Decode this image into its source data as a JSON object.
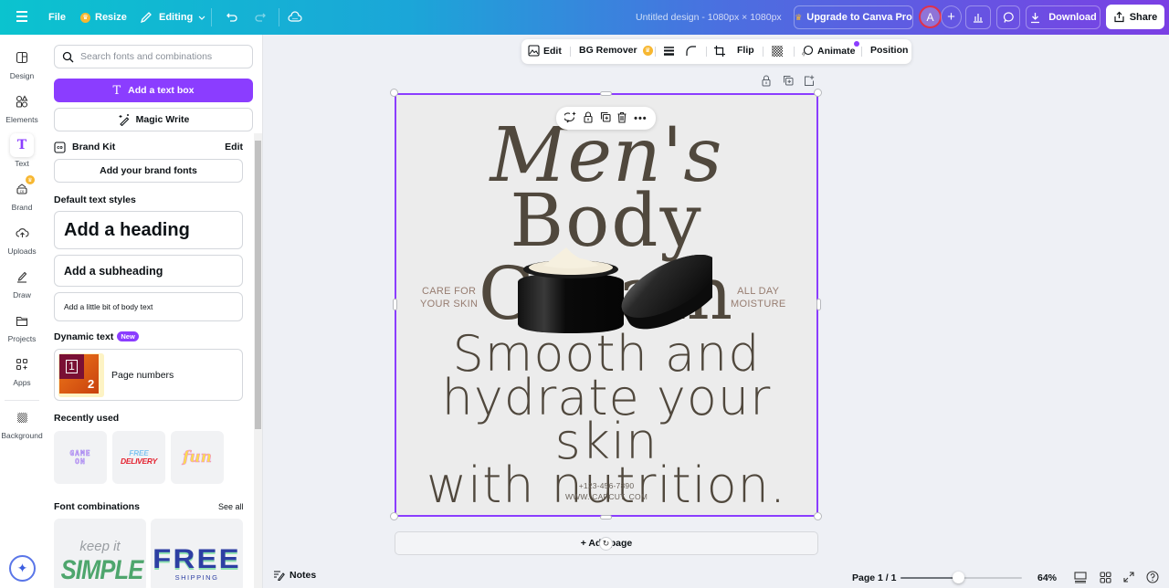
{
  "topbar": {
    "menu_icon": "hamburger-menu-icon",
    "file_label": "File",
    "resize_label": "Resize",
    "editing_label": "Editing",
    "design_title": "Untitled design - 1080px × 1080px",
    "upgrade_label": "Upgrade to Canva Pro",
    "avatar_initial": "A",
    "download_label": "Download",
    "share_label": "Share"
  },
  "rail": {
    "items": [
      {
        "label": "Design",
        "icon": "layout-icon"
      },
      {
        "label": "Elements",
        "icon": "shapes-icon"
      },
      {
        "label": "Text",
        "icon": "text-icon",
        "active": true
      },
      {
        "label": "Brand",
        "icon": "brand-icon"
      },
      {
        "label": "Uploads",
        "icon": "cloud-upload-icon"
      },
      {
        "label": "Draw",
        "icon": "pen-icon"
      },
      {
        "label": "Projects",
        "icon": "folder-icon"
      },
      {
        "label": "Apps",
        "icon": "apps-icon"
      },
      {
        "label": "Background",
        "icon": "background-icon"
      }
    ]
  },
  "panel": {
    "search_placeholder": "Search fonts and combinations",
    "add_text_box_label": "Add a text box",
    "magic_write_label": "Magic Write",
    "brand_kit_label": "Brand Kit",
    "brand_kit_edit": "Edit",
    "add_brand_fonts_label": "Add your brand fonts",
    "default_styles_title": "Default text styles",
    "heading_label": "Add a heading",
    "subheading_label": "Add a subheading",
    "body_label": "Add a little bit of body text",
    "dynamic_text_title": "Dynamic text",
    "new_badge": "New",
    "page_numbers_label": "Page numbers",
    "page_numbers_thumb": [
      "1",
      "2"
    ],
    "recently_used_title": "Recently used",
    "recent": [
      {
        "line1": "GAME",
        "line2": "ON"
      },
      {
        "line1": "FREE",
        "line2": "DELIVERY"
      },
      {
        "line1": "fun",
        "line2": ""
      }
    ],
    "font_combos_title": "Font combinations",
    "see_all": "See all",
    "combos": [
      {
        "line1": "keep it",
        "line2": "SIMPLE"
      },
      {
        "line1": "FREE",
        "line2": "SHIPPING"
      }
    ]
  },
  "context_toolbar": {
    "edit": "Edit",
    "bg_remover": "BG Remover",
    "flip": "Flip",
    "animate": "Animate",
    "position": "Position"
  },
  "design": {
    "title_line1": "Men's",
    "title_line2": "Body Cream",
    "left_tag_1": "CARE FOR",
    "left_tag_2": "YOUR SKIN",
    "right_tag_1": "ALL DAY",
    "right_tag_2": "MOISTURE",
    "body_line1": "Smooth and",
    "body_line2": "hydrate your skin",
    "body_line3": "with nutrition.",
    "phone": "+123-456-7890",
    "website": "WWW. CAPCUT. COM"
  },
  "add_page_label": "+ Add page",
  "footer": {
    "notes_label": "Notes",
    "page_indicator": "Page 1 / 1",
    "zoom_percent": 64,
    "zoom_label": "64%",
    "zoom_slider_fraction": 0.48
  }
}
